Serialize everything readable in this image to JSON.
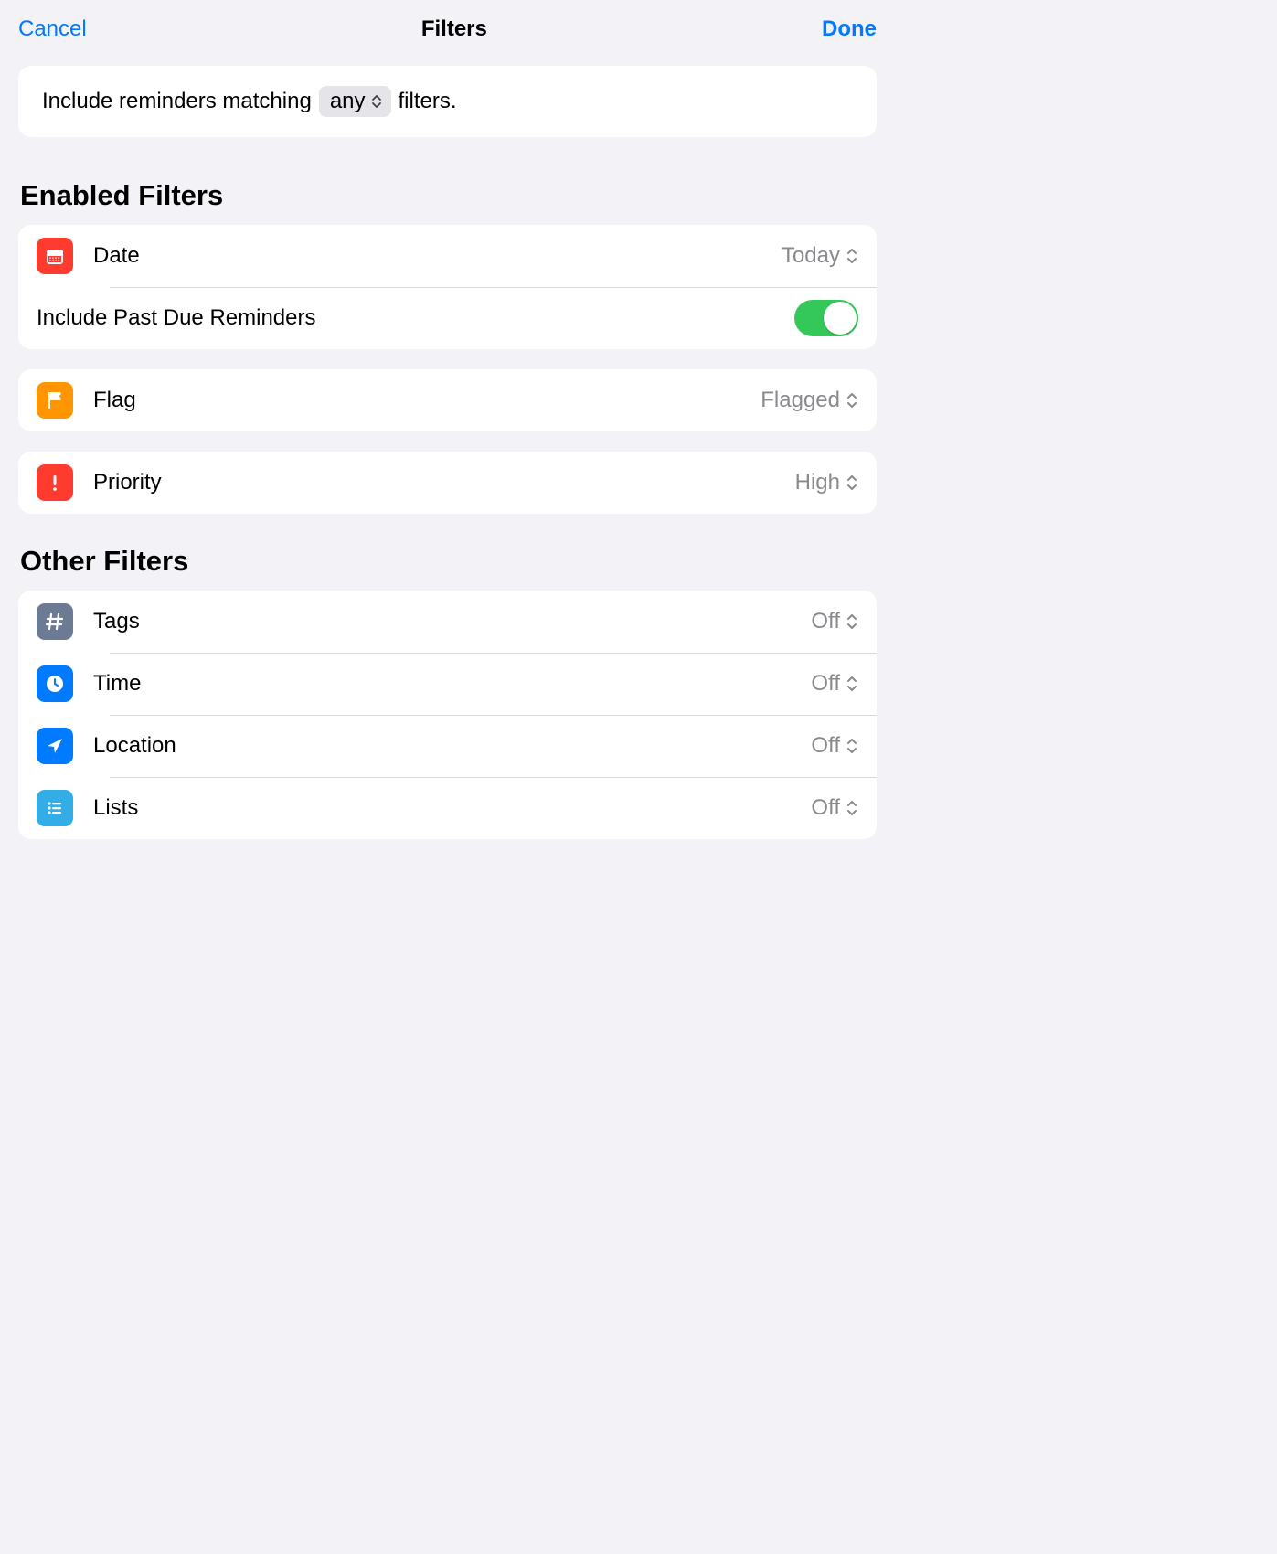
{
  "header": {
    "cancel_label": "Cancel",
    "title": "Filters",
    "done_label": "Done"
  },
  "match": {
    "prefix": "Include reminders matching",
    "selector_value": "any",
    "suffix": "filters."
  },
  "sections": {
    "enabled": {
      "title": "Enabled Filters",
      "date": {
        "label": "Date",
        "value": "Today"
      },
      "past_due": {
        "label": "Include Past Due Reminders",
        "on": true
      },
      "flag": {
        "label": "Flag",
        "value": "Flagged"
      },
      "priority": {
        "label": "Priority",
        "value": "High"
      }
    },
    "other": {
      "title": "Other Filters",
      "tags": {
        "label": "Tags",
        "value": "Off"
      },
      "time": {
        "label": "Time",
        "value": "Off"
      },
      "location": {
        "label": "Location",
        "value": "Off"
      },
      "lists": {
        "label": "Lists",
        "value": "Off"
      }
    }
  },
  "icons": {
    "date": "calendar-icon",
    "flag": "flag-icon",
    "priority": "exclamation-icon",
    "tags": "hash-icon",
    "time": "clock-icon",
    "location": "location-arrow-icon",
    "lists": "list-icon"
  },
  "colors": {
    "accent_blue": "#007aff",
    "toggle_green": "#34c759",
    "bg": "#f2f2f7",
    "secondary_text": "#8a8a8e"
  }
}
